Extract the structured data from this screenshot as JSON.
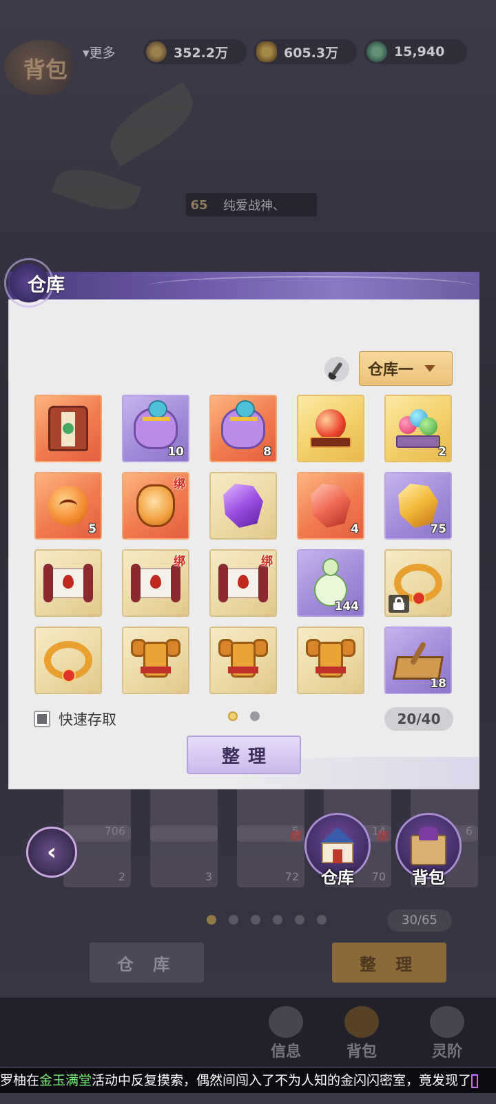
{
  "background": {
    "title": "背包",
    "currency": {
      "more_label": "更多",
      "items": [
        {
          "icon": "coin-icon",
          "value": "352.2万"
        },
        {
          "icon": "gold-ingot-icon",
          "value": "605.3万"
        },
        {
          "icon": "jade-icon",
          "value": "15,940"
        }
      ]
    },
    "player": {
      "level": "65",
      "name": "纯爱战神、"
    },
    "grid_counts_row1": [
      "706",
      "",
      "5",
      "14",
      "6"
    ],
    "grid_counts_row2": [
      "2",
      "3",
      "72",
      "70",
      ""
    ],
    "bind_label": "绑",
    "capacity": "30/65",
    "buttons": {
      "storage": "仓 库",
      "sort": "整 理"
    },
    "bottom_tabs": [
      "信息",
      "背包",
      "灵阶"
    ]
  },
  "nav": {
    "back_icon": "back-arrow-icon",
    "storage_label": "仓库",
    "bag_label": "背包"
  },
  "modal": {
    "title": "仓库",
    "storage_select": "仓库一",
    "quick_access_label": "快速存取",
    "capacity": "20/40",
    "sort_label": "整理",
    "page_count": 2,
    "active_page": 1,
    "items": [
      {
        "art": "robe",
        "rarity": "orange",
        "qty": "",
        "bind": false,
        "locked": false
      },
      {
        "art": "pouch",
        "rarity": "purple",
        "qty": "10",
        "bind": false,
        "locked": false
      },
      {
        "art": "pouch",
        "rarity": "orange",
        "qty": "8",
        "bind": false,
        "locked": false
      },
      {
        "art": "orb",
        "rarity": "gold",
        "qty": "",
        "bind": false,
        "locked": false
      },
      {
        "art": "balls",
        "rarity": "gold",
        "qty": "2",
        "bind": false,
        "locked": false
      },
      {
        "art": "fox",
        "rarity": "orange",
        "qty": "5",
        "bind": false,
        "locked": false
      },
      {
        "art": "mask",
        "rarity": "orange",
        "qty": "",
        "bind": true,
        "locked": false
      },
      {
        "art": "gem-violet",
        "rarity": "tan",
        "qty": "",
        "bind": false,
        "locked": false
      },
      {
        "art": "gem-red",
        "rarity": "orange",
        "qty": "4",
        "bind": false,
        "locked": false
      },
      {
        "art": "gem-amber",
        "rarity": "purple",
        "qty": "75",
        "bind": false,
        "locked": false
      },
      {
        "art": "scroll",
        "rarity": "tan",
        "qty": "",
        "bind": false,
        "locked": false
      },
      {
        "art": "scroll",
        "rarity": "tan",
        "qty": "",
        "bind": true,
        "locked": false
      },
      {
        "art": "scroll",
        "rarity": "tan",
        "qty": "",
        "bind": true,
        "locked": false
      },
      {
        "art": "gourd",
        "rarity": "purple",
        "qty": "144",
        "bind": false,
        "locked": false
      },
      {
        "art": "ring",
        "rarity": "tan",
        "qty": "",
        "bind": false,
        "locked": true
      },
      {
        "art": "ring",
        "rarity": "tan",
        "qty": "",
        "bind": false,
        "locked": false
      },
      {
        "art": "armor",
        "rarity": "tan",
        "qty": "",
        "bind": false,
        "locked": false
      },
      {
        "art": "armor",
        "rarity": "tan",
        "qty": "",
        "bind": false,
        "locked": false
      },
      {
        "art": "armor",
        "rarity": "tan",
        "qty": "",
        "bind": false,
        "locked": false
      },
      {
        "art": "mortar",
        "rarity": "purple",
        "qty": "18",
        "bind": false,
        "locked": false
      }
    ],
    "bind_label": "绑"
  },
  "ticker": {
    "segments": [
      {
        "style": "w",
        "text": "罗柚"
      },
      {
        "style": "w",
        "text": "在"
      },
      {
        "style": "h2",
        "text": "金玉满堂"
      },
      {
        "style": "w",
        "text": "活动中反复摸索，偶然间闯入了不为人知的金闪闪密室，竟发现了"
      }
    ]
  },
  "colors": {
    "modal_header": "#6e5aa8",
    "select_bg": "#ecc27a",
    "sort_btn": "#cbbaea",
    "rarity_orange": "#f07b4e",
    "rarity_purple": "#9f88d8",
    "rarity_gold": "#f2cf6a",
    "rarity_tan": "#ead9a4"
  }
}
